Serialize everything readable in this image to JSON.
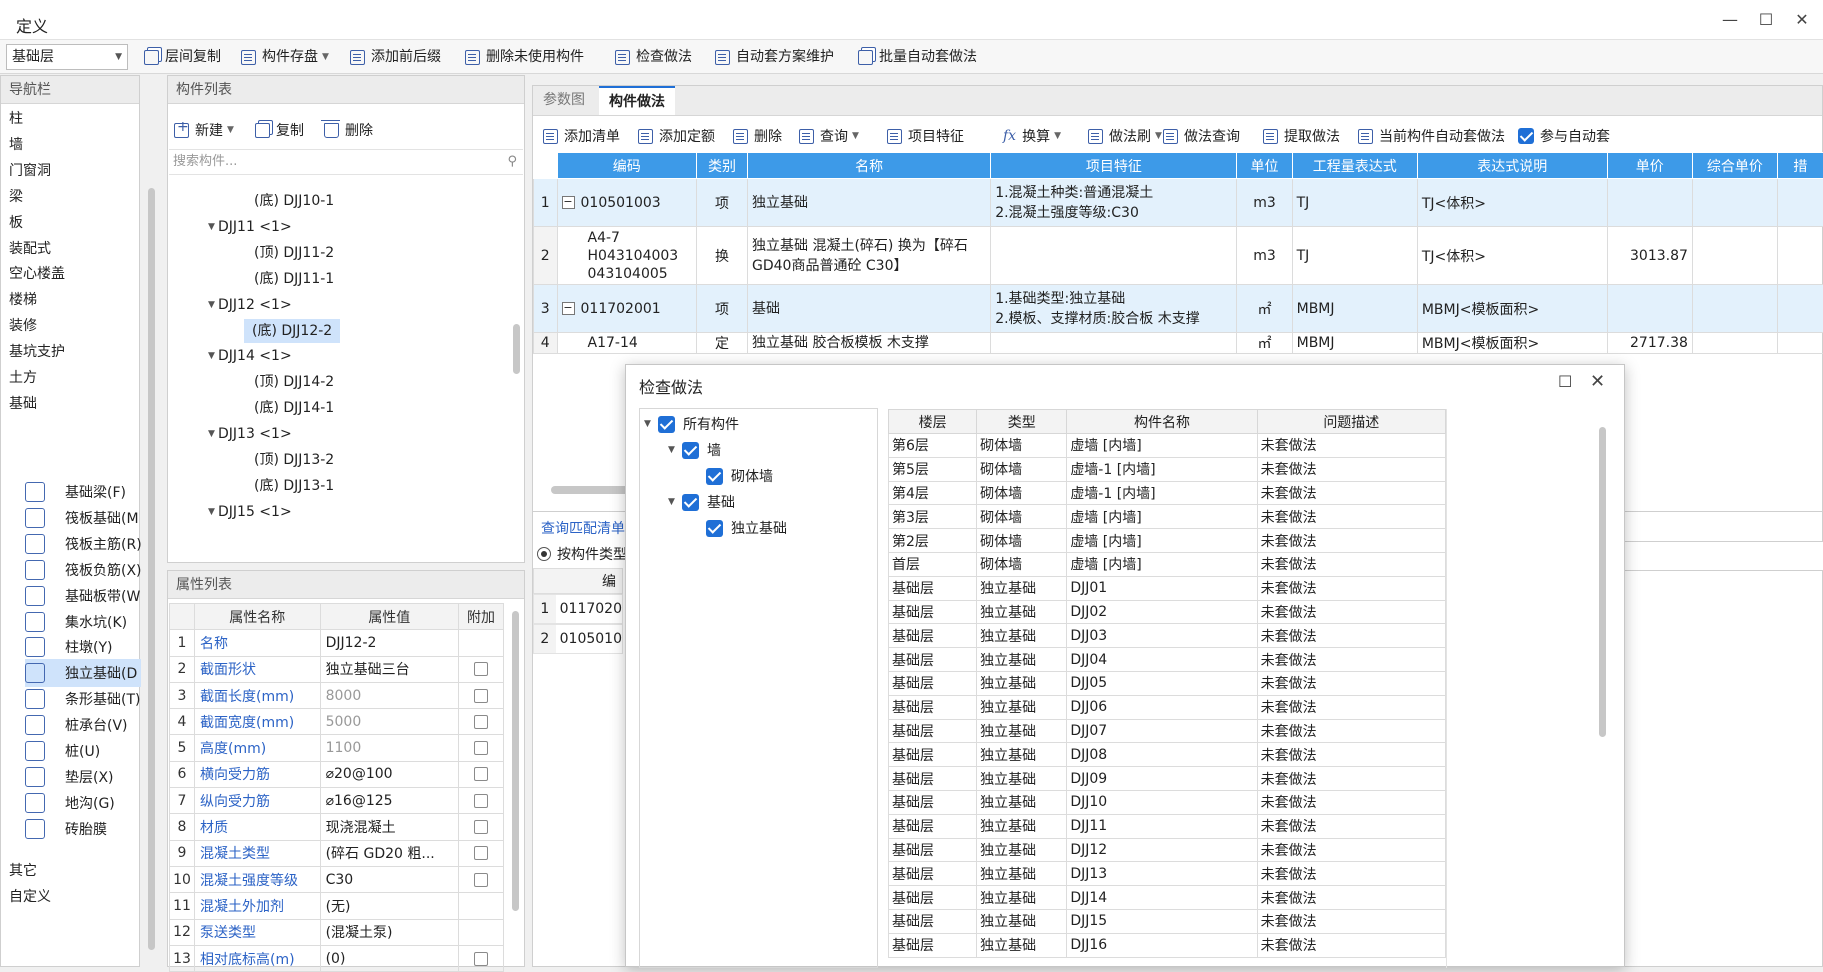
{
  "window": {
    "title": "定义"
  },
  "toolbar": {
    "floor_select": "基础层",
    "items": [
      "层间复制",
      "构件存盘",
      "添加前后缀",
      "删除未使用构件",
      "检查做法",
      "自动套方案维护",
      "批量自动套做法"
    ]
  },
  "nav": {
    "title": "导航栏",
    "top_items": [
      "柱",
      "墙",
      "门窗洞",
      "梁",
      "板",
      "装配式",
      "空心楼盖",
      "楼梯",
      "装修",
      "基坑支护",
      "土方",
      "基础"
    ],
    "sub_items": [
      "基础梁(F)",
      "筏板基础(M",
      "筏板主筋(R)",
      "筏板负筋(X)",
      "基础板带(W",
      "集水坑(K)",
      "柱墩(Y)",
      "独立基础(D",
      "条形基础(T)",
      "桩承台(V)",
      "桩(U)",
      "垫层(X)",
      "地沟(G)",
      "砖胎膜"
    ],
    "sub_icons": [
      "beam-icon",
      "raft-icon",
      "rebar-main-icon",
      "rebar-neg-icon",
      "strip-icon",
      "pit-icon",
      "pier-icon",
      "footing-icon",
      "strip-footing-icon",
      "cap-icon",
      "pile-icon",
      "cushion-icon",
      "trench-icon",
      "brick-mold-icon"
    ],
    "selected_sub": 7,
    "bottom_items": [
      "其它",
      "自定义"
    ]
  },
  "components": {
    "title": "构件列表",
    "new_label": "新建",
    "copy_label": "复制",
    "delete_label": "删除",
    "search_placeholder": "搜索构件...",
    "tree": [
      {
        "text": "(底) DJJ10-1",
        "level": 2
      },
      {
        "text": "DJJ11 <1>",
        "level": 1
      },
      {
        "text": "(顶) DJJ11-2",
        "level": 2
      },
      {
        "text": "(底) DJJ11-1",
        "level": 2
      },
      {
        "text": "DJJ12 <1>",
        "level": 1
      },
      {
        "text": "(底) DJJ12-2",
        "level": 2,
        "selected": true
      },
      {
        "text": "DJJ14 <1>",
        "level": 1
      },
      {
        "text": "(顶) DJJ14-2",
        "level": 2
      },
      {
        "text": "(底) DJJ14-1",
        "level": 2
      },
      {
        "text": "DJJ13 <1>",
        "level": 1
      },
      {
        "text": "(顶) DJJ13-2",
        "level": 2
      },
      {
        "text": "(底) DJJ13-1",
        "level": 2
      },
      {
        "text": "DJJ15 <1>",
        "level": 1
      }
    ]
  },
  "attributes": {
    "title": "属性列表",
    "headers": [
      "属性名称",
      "属性值",
      "附加"
    ],
    "rows": [
      {
        "n": "1",
        "name": "名称",
        "value": "DJJ12-2",
        "check": false
      },
      {
        "n": "2",
        "name": "截面形状",
        "value": "独立基础三台",
        "check": true
      },
      {
        "n": "3",
        "name": "截面长度(mm)",
        "value": "8000",
        "check": true,
        "gray": true
      },
      {
        "n": "4",
        "name": "截面宽度(mm)",
        "value": "5000",
        "check": true,
        "gray": true
      },
      {
        "n": "5",
        "name": "高度(mm)",
        "value": "1100",
        "check": true,
        "gray": true
      },
      {
        "n": "6",
        "name": "横向受力筋",
        "value": "⌀20@100",
        "check": true
      },
      {
        "n": "7",
        "name": "纵向受力筋",
        "value": "⌀16@125",
        "check": true
      },
      {
        "n": "8",
        "name": "材质",
        "value": "现浇混凝土",
        "check": true
      },
      {
        "n": "9",
        "name": "混凝土类型",
        "value": "(碎石 GD20 粗...",
        "check": true
      },
      {
        "n": "10",
        "name": "混凝土强度等级",
        "value": "C30",
        "check": true
      },
      {
        "n": "11",
        "name": "混凝土外加剂",
        "value": "(无)",
        "check": false
      },
      {
        "n": "12",
        "name": "泵送类型",
        "value": "(混凝土泵)",
        "check": false
      },
      {
        "n": "13",
        "name": "相对底标高(m)",
        "value": "(0)",
        "check": true
      }
    ]
  },
  "method": {
    "tabs": [
      "参数图",
      "构件做法"
    ],
    "toolbar": [
      "添加清单",
      "添加定额",
      "删除",
      "查询",
      "项目特征",
      "换算",
      "做法刷",
      "做法查询",
      "提取做法",
      "当前构件自动套做法",
      "参与自动套"
    ],
    "headers": [
      "编码",
      "类别",
      "名称",
      "项目特征",
      "单位",
      "工程量表达式",
      "表达式说明",
      "单价",
      "综合单价",
      "措"
    ],
    "rows": [
      {
        "n": "1",
        "code": "010501003",
        "type": "项",
        "name": "独立基础",
        "feature": "1.混凝土种类:普通混凝土\n2.混凝土强度等级:C30",
        "unit": "m3",
        "expr": "TJ",
        "desc": "TJ<体积>",
        "price": "",
        "hl": true,
        "minus": true
      },
      {
        "n": "2",
        "code": "A4-7\nH043104003\n043104005",
        "type": "换",
        "name": "独立基础 混凝土(碎石) 换为【碎石\nGD40商品普通砼 C30】",
        "feature": "",
        "unit": "m3",
        "expr": "TJ",
        "desc": "TJ<体积>",
        "price": "3013.87",
        "hl": false,
        "minus": false
      },
      {
        "n": "3",
        "code": "011702001",
        "type": "项",
        "name": "基础",
        "feature": "1.基础类型:独立基础\n2.模板、支撑材质:胶合板 木支撑",
        "unit": "㎡",
        "expr": "MBMJ",
        "desc": "MBMJ<模板面积>",
        "price": "",
        "hl": true,
        "minus": true
      },
      {
        "n": "4",
        "code": "A17-14",
        "type": "定",
        "name": "独立基础 胶合板模板 木支撑",
        "feature": "",
        "unit": "㎡",
        "expr": "MBMJ",
        "desc": "MBMJ<模板面积>",
        "price": "2717.38",
        "hl": false,
        "minus": false
      }
    ],
    "query_tab": "查询匹配清单",
    "radio_label": "按构件类型",
    "query_header": "编",
    "query_rows": [
      {
        "n": "1",
        "code": "0117020"
      },
      {
        "n": "2",
        "code": "0105010"
      }
    ]
  },
  "dialog": {
    "title": "检查做法",
    "tree": [
      {
        "text": "所有构件",
        "level": 0
      },
      {
        "text": "墙",
        "level": 1
      },
      {
        "text": "砌体墙",
        "level": 2
      },
      {
        "text": "基础",
        "level": 1
      },
      {
        "text": "独立基础",
        "level": 2
      }
    ],
    "headers": [
      "楼层",
      "类型",
      "构件名称",
      "问题描述"
    ],
    "rows": [
      [
        "第6层",
        "砌体墙",
        "虚墙 [内墙]",
        "未套做法"
      ],
      [
        "第5层",
        "砌体墙",
        "虚墙-1 [内墙]",
        "未套做法"
      ],
      [
        "第4层",
        "砌体墙",
        "虚墙-1 [内墙]",
        "未套做法"
      ],
      [
        "第3层",
        "砌体墙",
        "虚墙 [内墙]",
        "未套做法"
      ],
      [
        "第2层",
        "砌体墙",
        "虚墙 [内墙]",
        "未套做法"
      ],
      [
        "首层",
        "砌体墙",
        "虚墙 [内墙]",
        "未套做法"
      ],
      [
        "基础层",
        "独立基础",
        "DJJ01",
        "未套做法"
      ],
      [
        "基础层",
        "独立基础",
        "DJJ02",
        "未套做法"
      ],
      [
        "基础层",
        "独立基础",
        "DJJ03",
        "未套做法"
      ],
      [
        "基础层",
        "独立基础",
        "DJJ04",
        "未套做法"
      ],
      [
        "基础层",
        "独立基础",
        "DJJ05",
        "未套做法"
      ],
      [
        "基础层",
        "独立基础",
        "DJJ06",
        "未套做法"
      ],
      [
        "基础层",
        "独立基础",
        "DJJ07",
        "未套做法"
      ],
      [
        "基础层",
        "独立基础",
        "DJJ08",
        "未套做法"
      ],
      [
        "基础层",
        "独立基础",
        "DJJ09",
        "未套做法"
      ],
      [
        "基础层",
        "独立基础",
        "DJJ10",
        "未套做法"
      ],
      [
        "基础层",
        "独立基础",
        "DJJ11",
        "未套做法"
      ],
      [
        "基础层",
        "独立基础",
        "DJJ12",
        "未套做法"
      ],
      [
        "基础层",
        "独立基础",
        "DJJ13",
        "未套做法"
      ],
      [
        "基础层",
        "独立基础",
        "DJJ14",
        "未套做法"
      ],
      [
        "基础层",
        "独立基础",
        "DJJ15",
        "未套做法"
      ],
      [
        "基础层",
        "独立基础",
        "DJJ16",
        "未套做法"
      ]
    ]
  },
  "colors": {
    "accent": "#1f6fd6",
    "header_blue": "#3d9ae8",
    "selection": "#cfe3fb",
    "link_text": "#2c63c6"
  }
}
